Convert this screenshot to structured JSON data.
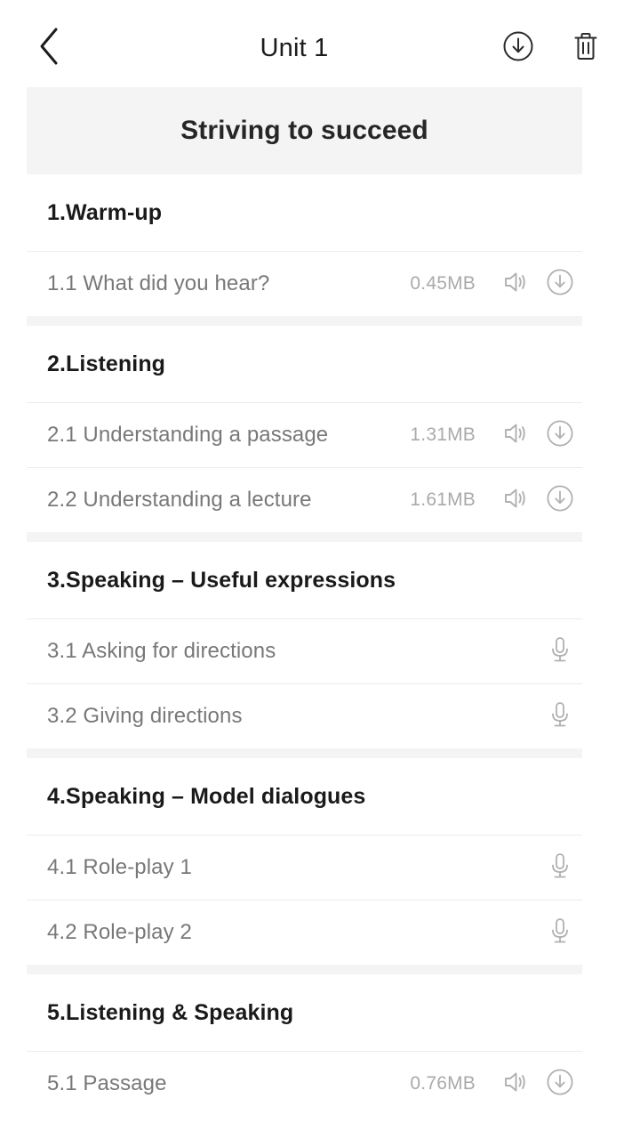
{
  "navbar": {
    "title": "Unit 1",
    "back_icon": "chevron-left-icon",
    "download_all_icon": "download-circle-icon",
    "delete_icon": "trash-icon"
  },
  "unit_banner": {
    "title": "Striving to succeed"
  },
  "colors": {
    "page_background": "#ffffff",
    "band_background": "#f4f4f4",
    "section_title": "#1a1a1a",
    "row_text": "#787878",
    "size_text": "#aaaaaa",
    "divider": "#ececec",
    "nav_title": "#1c1c1c"
  },
  "icons": {
    "speaker": "speaker-icon",
    "download": "download-circle-icon",
    "microphone": "microphone-icon"
  },
  "sections": [
    {
      "title": "1.Warm-up",
      "rows": [
        {
          "label": "1.1 What did you hear?",
          "size": "0.45MB",
          "actions": [
            "speaker",
            "download"
          ]
        }
      ]
    },
    {
      "title": "2.Listening",
      "rows": [
        {
          "label": "2.1 Understanding a passage",
          "size": "1.31MB",
          "actions": [
            "speaker",
            "download"
          ]
        },
        {
          "label": "2.2 Understanding a lecture",
          "size": "1.61MB",
          "actions": [
            "speaker",
            "download"
          ]
        }
      ]
    },
    {
      "title": "3.Speaking – Useful expressions",
      "rows": [
        {
          "label": "3.1 Asking for directions",
          "size": "",
          "actions": [
            "microphone"
          ]
        },
        {
          "label": "3.2 Giving directions",
          "size": "",
          "actions": [
            "microphone"
          ]
        }
      ]
    },
    {
      "title": "4.Speaking – Model dialogues",
      "rows": [
        {
          "label": "4.1 Role-play 1",
          "size": "",
          "actions": [
            "microphone"
          ]
        },
        {
          "label": "4.2 Role-play 2",
          "size": "",
          "actions": [
            "microphone"
          ]
        }
      ]
    },
    {
      "title": "5.Listening & Speaking",
      "rows": [
        {
          "label": "5.1 Passage",
          "size": "0.76MB",
          "actions": [
            "speaker",
            "download"
          ]
        }
      ]
    }
  ]
}
